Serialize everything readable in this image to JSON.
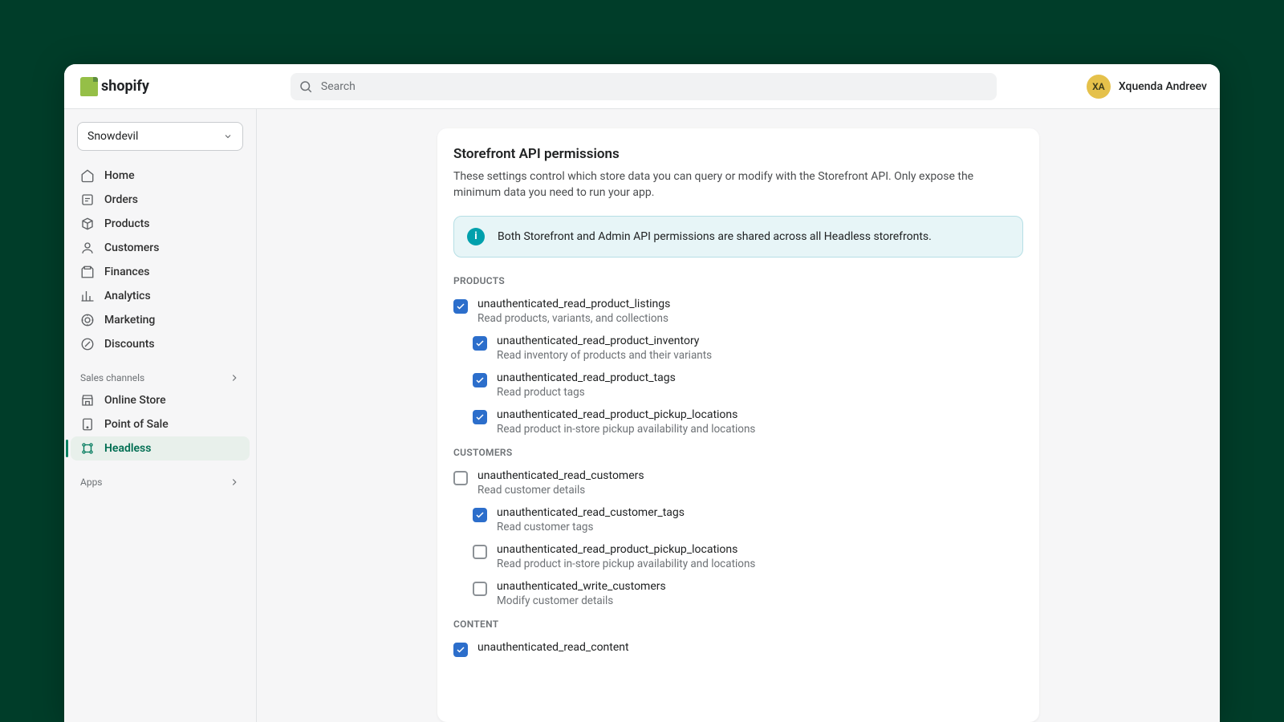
{
  "brand": "shopify",
  "search": {
    "placeholder": "Search"
  },
  "user": {
    "initials": "XA",
    "name": "Xquenda Andreev"
  },
  "store_selector": {
    "value": "Snowdevil"
  },
  "nav": {
    "primary": [
      {
        "label": "Home",
        "icon": "home"
      },
      {
        "label": "Orders",
        "icon": "orders"
      },
      {
        "label": "Products",
        "icon": "products"
      },
      {
        "label": "Customers",
        "icon": "customers"
      },
      {
        "label": "Finances",
        "icon": "finances"
      },
      {
        "label": "Analytics",
        "icon": "analytics"
      },
      {
        "label": "Marketing",
        "icon": "marketing"
      },
      {
        "label": "Discounts",
        "icon": "discounts"
      }
    ],
    "sales_channels_label": "Sales channels",
    "sales_channels": [
      {
        "label": "Online Store",
        "icon": "store"
      },
      {
        "label": "Point of Sale",
        "icon": "pos"
      },
      {
        "label": "Headless",
        "icon": "headless",
        "active": true
      }
    ],
    "apps_label": "Apps"
  },
  "page": {
    "title": "Storefront API permissions",
    "subtitle": "These settings control which store data you can query or modify with the Storefront API. Only expose the minimum data you need to run your app.",
    "banner": "Both Storefront and Admin API permissions are shared across all Headless storefronts.",
    "sections": [
      {
        "heading": "PRODUCTS",
        "items": [
          {
            "name": "unauthenticated_read_product_listings",
            "desc": "Read products, variants, and collections",
            "checked": true,
            "child": false
          },
          {
            "name": "unauthenticated_read_product_inventory",
            "desc": "Read inventory of products and their variants",
            "checked": true,
            "child": true
          },
          {
            "name": "unauthenticated_read_product_tags",
            "desc": "Read product tags",
            "checked": true,
            "child": true
          },
          {
            "name": "unauthenticated_read_product_pickup_locations",
            "desc": "Read product in-store pickup availability and locations",
            "checked": true,
            "child": true
          }
        ]
      },
      {
        "heading": "CUSTOMERS",
        "items": [
          {
            "name": "unauthenticated_read_customers",
            "desc": "Read customer details",
            "checked": false,
            "child": false
          },
          {
            "name": "unauthenticated_read_customer_tags",
            "desc": "Read customer tags",
            "checked": true,
            "child": true
          },
          {
            "name": "unauthenticated_read_product_pickup_locations",
            "desc": "Read product in-store pickup availability and locations",
            "checked": false,
            "child": true
          },
          {
            "name": "unauthenticated_write_customers",
            "desc": "Modify customer details",
            "checked": false,
            "child": true
          }
        ]
      },
      {
        "heading": "CONTENT",
        "items": [
          {
            "name": "unauthenticated_read_content",
            "desc": "",
            "checked": true,
            "child": false
          }
        ]
      }
    ]
  }
}
